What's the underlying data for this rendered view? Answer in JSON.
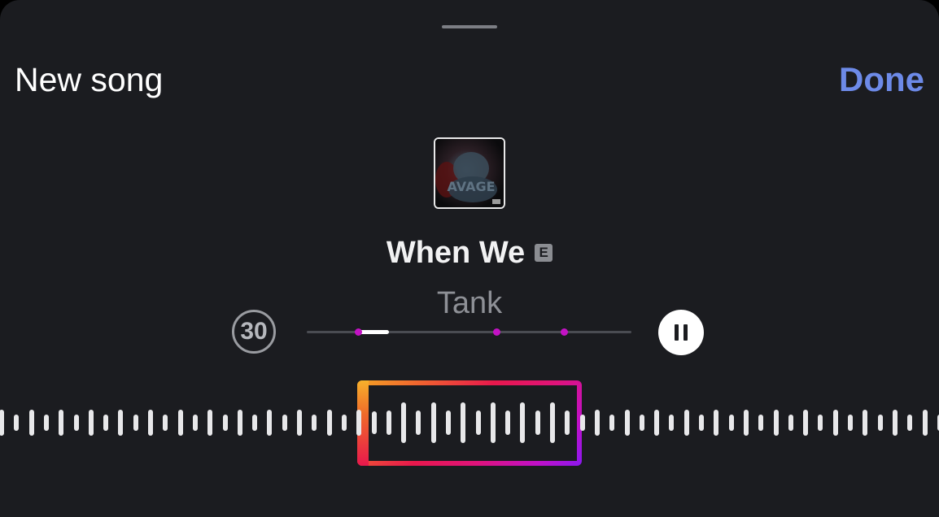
{
  "header": {
    "title": "New song",
    "done_label": "Done"
  },
  "song": {
    "title": "When We",
    "explicit_badge": "E",
    "artist": "Tank",
    "artwork_text": "AVAGE"
  },
  "player": {
    "duration_label": "30",
    "state": "playing",
    "pause_icon": "pause-icon",
    "progress_fraction": 0.16
  },
  "colors": {
    "background": "#1b1c20",
    "accent": "#6d8ae8",
    "marker": "#c312c4",
    "selector_gradient": [
      "#f5a623",
      "#e8184c",
      "#c010c8",
      "#8a18f0"
    ]
  }
}
